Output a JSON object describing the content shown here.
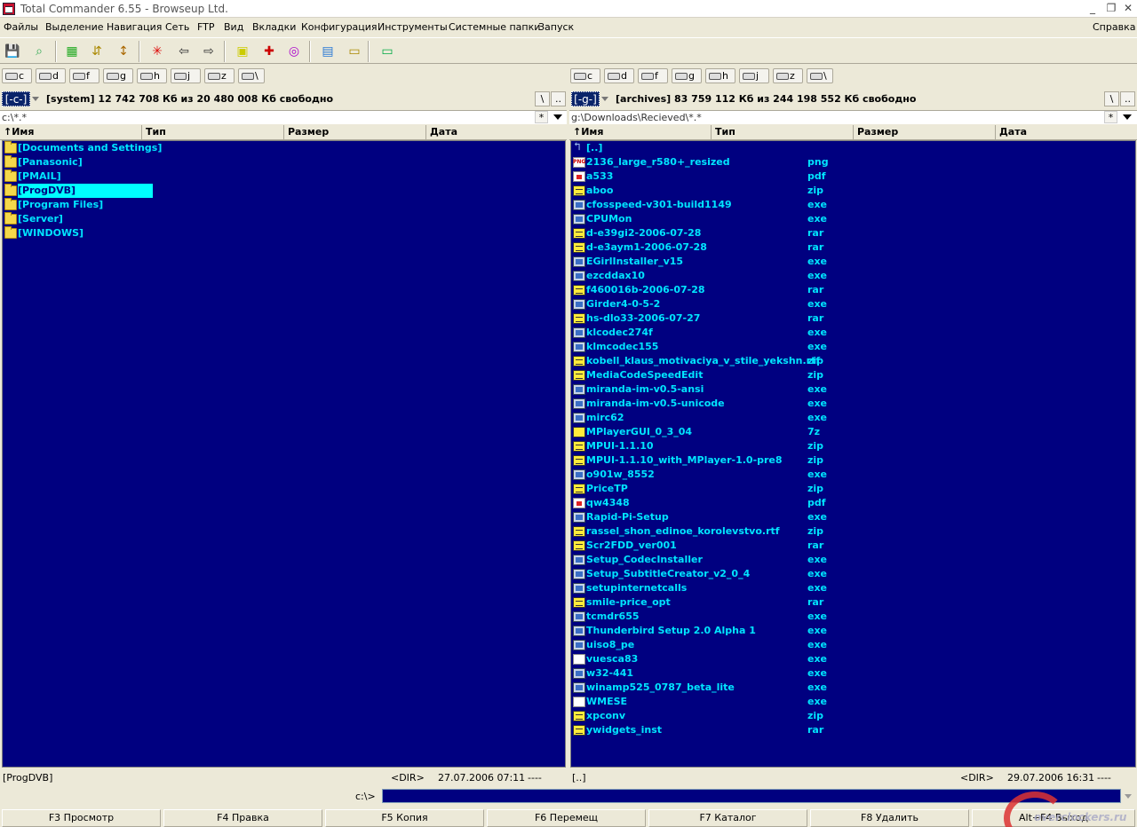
{
  "window": {
    "title": "Total Commander 6.55 - Browseup Ltd.",
    "min": "_",
    "restore": "❐",
    "close": "✕"
  },
  "menu": [
    "Файлы",
    "Выделение",
    "Навигация",
    "Сеть",
    "FTP",
    "Вид",
    "Вкладки",
    "Конфигурация",
    "Инструменты",
    "Системные папки",
    "Запуск"
  ],
  "menu_help": "Справка",
  "toolbar": [
    {
      "name": "refresh-icon",
      "glyph": "💾",
      "color": "#1a3a8a"
    },
    {
      "name": "view-mode-icon",
      "glyph": "⌕",
      "color": "#3a5"
    },
    {
      "name": "brief-view-icon",
      "glyph": "▦",
      "color": "#2a2"
    },
    {
      "name": "tree-view-icon",
      "glyph": "⇵",
      "color": "#a80"
    },
    {
      "name": "sort-icon",
      "glyph": "↕",
      "color": "#a60"
    },
    {
      "name": "select-icon",
      "glyph": "✳",
      "color": "#d00"
    },
    {
      "name": "back-icon",
      "glyph": "⇦",
      "color": "#333"
    },
    {
      "name": "forward-icon",
      "glyph": "⇨",
      "color": "#333"
    },
    {
      "name": "pack-icon",
      "glyph": "▣",
      "color": "#cc0"
    },
    {
      "name": "ftp-icon",
      "glyph": "✚",
      "color": "#c00"
    },
    {
      "name": "url-icon",
      "glyph": "◎",
      "color": "#a0c"
    },
    {
      "name": "notepad-icon",
      "glyph": "▤",
      "color": "#2a7ad5"
    },
    {
      "name": "folder-view-icon",
      "glyph": "▭",
      "color": "#a80"
    },
    {
      "name": "window-icon",
      "glyph": "▭",
      "color": "#0a4"
    }
  ],
  "drives": [
    "c",
    "d",
    "f",
    "g",
    "h",
    "j",
    "z",
    "\\"
  ],
  "left": {
    "drive": "[-c-]",
    "space": "[system]  12 742 708 Кб из 20 480 008 Кб свободно",
    "root_btn": "\\",
    "up_btn": "..",
    "path": "c:\\*.*",
    "filter_btn": "*",
    "cols": [
      "↑Имя",
      "Тип",
      "Размер",
      "Дата"
    ],
    "files": [
      {
        "name": "[Documents and Settings]",
        "ext": "",
        "icon": "folder"
      },
      {
        "name": "[Panasonic]",
        "ext": "",
        "icon": "folder"
      },
      {
        "name": "[PMAIL]",
        "ext": "",
        "icon": "folder"
      },
      {
        "name": "[ProgDVB]",
        "ext": "",
        "icon": "folder",
        "selected": true
      },
      {
        "name": "[Program Files]",
        "ext": "",
        "icon": "folder"
      },
      {
        "name": "[Server]",
        "ext": "",
        "icon": "folder"
      },
      {
        "name": "[WINDOWS]",
        "ext": "",
        "icon": "folder"
      }
    ],
    "status_name": "[ProgDVB]",
    "status_dir": "<DIR>",
    "status_date": "27.07.2006 07:11",
    "status_attr": "----"
  },
  "right": {
    "drive": "[-g-]",
    "space": "[archives]  83 759 112 Кб из 244 198 552 Кб свободно",
    "root_btn": "\\",
    "up_btn": "..",
    "path": "g:\\Downloads\\Recieved\\*.*",
    "filter_btn": "*",
    "cols": [
      "↑Имя",
      "Тип",
      "Размер",
      "Дата"
    ],
    "files": [
      {
        "name": "[..]",
        "ext": "",
        "icon": "up"
      },
      {
        "name": "2136_large_r580+_resized",
        "ext": "png",
        "icon": "png"
      },
      {
        "name": "a533",
        "ext": "pdf",
        "icon": "pdf"
      },
      {
        "name": "aboo",
        "ext": "zip",
        "icon": "zip"
      },
      {
        "name": "cfosspeed-v301-build1149",
        "ext": "exe",
        "icon": "exe"
      },
      {
        "name": "CPUMon",
        "ext": "exe",
        "icon": "exe"
      },
      {
        "name": "d-e39gi2-2006-07-28",
        "ext": "rar",
        "icon": "zip"
      },
      {
        "name": "d-e3aym1-2006-07-28",
        "ext": "rar",
        "icon": "zip"
      },
      {
        "name": "EGirlInstaller_v15",
        "ext": "exe",
        "icon": "exe"
      },
      {
        "name": "ezcddax10",
        "ext": "exe",
        "icon": "exe"
      },
      {
        "name": "f460016b-2006-07-28",
        "ext": "rar",
        "icon": "zip"
      },
      {
        "name": "Girder4-0-5-2",
        "ext": "exe",
        "icon": "exe"
      },
      {
        "name": "hs-dlo33-2006-07-27",
        "ext": "rar",
        "icon": "zip"
      },
      {
        "name": "klcodec274f",
        "ext": "exe",
        "icon": "exe"
      },
      {
        "name": "klmcodec155",
        "ext": "exe",
        "icon": "exe"
      },
      {
        "name": "kobell_klaus_motivaciya_v_stile_yekshn.rtf",
        "ext": "zip",
        "icon": "zip"
      },
      {
        "name": "MediaCodeSpeedEdit",
        "ext": "zip",
        "icon": "zip"
      },
      {
        "name": "miranda-im-v0.5-ansi",
        "ext": "exe",
        "icon": "exe"
      },
      {
        "name": "miranda-im-v0.5-unicode",
        "ext": "exe",
        "icon": "exe"
      },
      {
        "name": "mirc62",
        "ext": "exe",
        "icon": "exe"
      },
      {
        "name": "MPlayerGUI_0_3_04",
        "ext": "7z",
        "icon": "7z"
      },
      {
        "name": "MPUI-1.1.10",
        "ext": "zip",
        "icon": "zip"
      },
      {
        "name": "MPUI-1.1.10_with_MPlayer-1.0-pre8",
        "ext": "zip",
        "icon": "zip"
      },
      {
        "name": "o901w_8552",
        "ext": "exe",
        "icon": "exe"
      },
      {
        "name": "PriceTP",
        "ext": "zip",
        "icon": "zip"
      },
      {
        "name": "qw4348",
        "ext": "pdf",
        "icon": "pdf"
      },
      {
        "name": "Rapid-Pi-Setup",
        "ext": "exe",
        "icon": "exe"
      },
      {
        "name": "rassel_shon_edinoe_korolevstvo.rtf",
        "ext": "zip",
        "icon": "zip"
      },
      {
        "name": "Scr2FDD_ver001",
        "ext": "rar",
        "icon": "zip"
      },
      {
        "name": "Setup_CodecInstaller",
        "ext": "exe",
        "icon": "exe"
      },
      {
        "name": "Setup_SubtitleCreator_v2_0_4",
        "ext": "exe",
        "icon": "exe"
      },
      {
        "name": "setupinternetcalls",
        "ext": "exe",
        "icon": "exe"
      },
      {
        "name": "smile-price_opt",
        "ext": "rar",
        "icon": "zip"
      },
      {
        "name": "tcmdr655",
        "ext": "exe",
        "icon": "exe"
      },
      {
        "name": "Thunderbird Setup 2.0 Alpha 1",
        "ext": "exe",
        "icon": "exe"
      },
      {
        "name": "uiso8_pe",
        "ext": "exe",
        "icon": "exe"
      },
      {
        "name": "vuesca83",
        "ext": "exe",
        "icon": "blank"
      },
      {
        "name": "w32-441",
        "ext": "exe",
        "icon": "exe"
      },
      {
        "name": "winamp525_0787_beta_lite",
        "ext": "exe",
        "icon": "exe"
      },
      {
        "name": "WMESE",
        "ext": "exe",
        "icon": "blank"
      },
      {
        "name": "xpconv",
        "ext": "zip",
        "icon": "zip"
      },
      {
        "name": "ywidgets_inst",
        "ext": "rar",
        "icon": "zip"
      }
    ],
    "status_name": "[..]",
    "status_dir": "<DIR>",
    "status_date": "29.07.2006 16:31",
    "status_attr": "----"
  },
  "cmd": {
    "label": "c:\\>"
  },
  "fkeys": [
    "F3 Просмотр",
    "F4 Правка",
    "F5 Копия",
    "F6 Перемещ",
    "F7 Каталог",
    "F8 Удалить",
    "Alt+F4 Выход"
  ],
  "watermark": "overclockers.ru"
}
